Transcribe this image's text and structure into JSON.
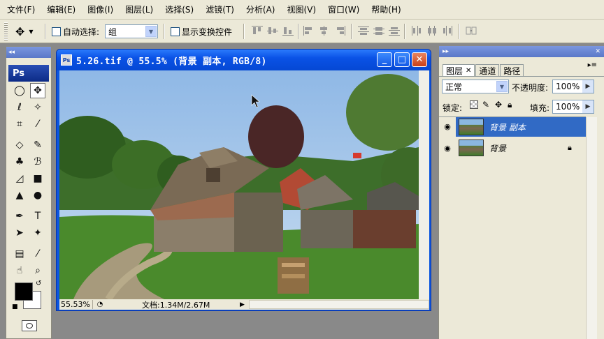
{
  "menubar": {
    "items": [
      "文件(F)",
      "编辑(E)",
      "图像(I)",
      "图层(L)",
      "选择(S)",
      "滤镜(T)",
      "分析(A)",
      "视图(V)",
      "窗口(W)",
      "帮助(H)"
    ]
  },
  "options": {
    "auto_select_label": "自动选择:",
    "auto_select_value": "组",
    "show_transform_label": "显示变换控件"
  },
  "toolbox": {
    "logo": "Ps",
    "tools": [
      {
        "icon": "elliptical-marquee-icon",
        "glyph": "◯"
      },
      {
        "icon": "move-tool-icon",
        "glyph": "✥",
        "selected": true
      },
      {
        "icon": "lasso-icon",
        "glyph": "ℓ"
      },
      {
        "icon": "magic-wand-icon",
        "glyph": "✧"
      },
      {
        "icon": "crop-icon",
        "glyph": "⌗"
      },
      {
        "icon": "slice-icon",
        "glyph": "⁄"
      },
      {
        "icon": "eraser-icon",
        "glyph": "◇"
      },
      {
        "icon": "brush-icon",
        "glyph": "✎"
      },
      {
        "icon": "stamp-icon",
        "glyph": "♣"
      },
      {
        "icon": "history-brush-icon",
        "glyph": "ℬ"
      },
      {
        "icon": "smudge-eraser-icon",
        "glyph": "◿"
      },
      {
        "icon": "gradient-icon",
        "glyph": "■"
      },
      {
        "icon": "blur-icon",
        "glyph": "▲"
      },
      {
        "icon": "dodge-icon",
        "glyph": "●"
      },
      {
        "icon": "pen-icon",
        "glyph": "✒"
      },
      {
        "icon": "type-icon",
        "glyph": "T"
      },
      {
        "icon": "path-selection-icon",
        "glyph": "➤"
      },
      {
        "icon": "custom-shape-icon",
        "glyph": "✦"
      },
      {
        "icon": "notes-icon",
        "glyph": "▤"
      },
      {
        "icon": "eyedropper-icon",
        "glyph": "⁄"
      },
      {
        "icon": "hand-icon",
        "glyph": "☝"
      },
      {
        "icon": "zoom-icon",
        "glyph": "⌕"
      }
    ]
  },
  "document": {
    "title": "5.26.tif @ 55.5% (背景 副本, RGB/8)",
    "zoom": "55.53%",
    "doc_info": "文档:1.34M/2.67M"
  },
  "layers_panel": {
    "tabs": [
      "图层",
      "通道",
      "路径"
    ],
    "blend_mode": "正常",
    "opacity_label": "不透明度:",
    "opacity_value": "100%",
    "lock_label": "锁定:",
    "fill_label": "填充:",
    "fill_value": "100%",
    "layers": [
      {
        "name": "背景 副本",
        "selected": true,
        "visible": true,
        "locked": false
      },
      {
        "name": "背景",
        "selected": false,
        "visible": true,
        "locked": true
      }
    ]
  },
  "colors": {
    "title_blue": "#0a52e6",
    "selected_layer": "#316ac5",
    "chrome": "#ece9d8",
    "workspace": "#898989"
  }
}
